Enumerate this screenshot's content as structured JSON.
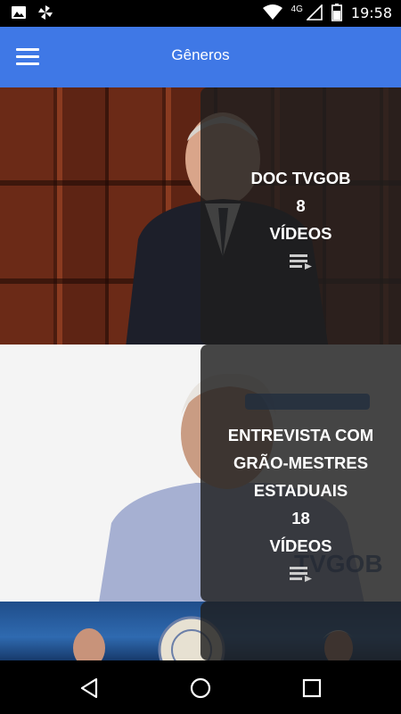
{
  "status_bar": {
    "network": "4G",
    "time": "19:58",
    "left_icons": [
      "image-icon",
      "pinwheel-icon"
    ],
    "right_icons": [
      "wifi-icon",
      "signal-icon",
      "battery-icon"
    ]
  },
  "app_bar": {
    "title": "Gêneros",
    "menu_icon": "hamburger-menu-icon"
  },
  "genres": [
    {
      "title_lines": [
        "DOC TVGOB"
      ],
      "count": "8",
      "unit": "VÍDEOS"
    },
    {
      "title_lines": [
        "ENTREVISTA COM",
        "GRÃO-MESTRES",
        "ESTADUAIS"
      ],
      "count": "18",
      "unit": "VÍDEOS"
    },
    {
      "title_lines": [],
      "count": "",
      "unit": ""
    }
  ],
  "nav_bar": {
    "buttons": [
      "back-icon",
      "home-icon",
      "recents-icon"
    ]
  },
  "colors": {
    "app_bar": "#3f78e6",
    "overlay": "#1e1e1e",
    "status_bar": "#000000"
  }
}
